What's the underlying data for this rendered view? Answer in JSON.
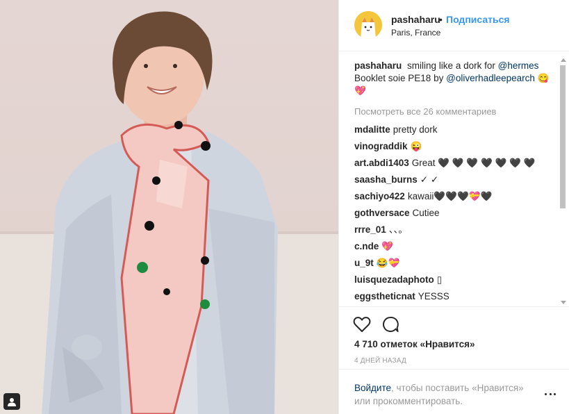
{
  "post": {
    "username": "pashaharu",
    "separator": "•",
    "follow_label": "Подписаться",
    "location": "Paris, France",
    "caption": {
      "username": "pashaharu",
      "text_1": "smiling like a dork for",
      "mention_1": "@hermes",
      "text_2": "Booklet soie PE18 by",
      "mention_2": "@oliverhadleepearch",
      "emoji": "😋💖"
    },
    "load_more_label": "Посмотреть все 26 комментариев",
    "comments": [
      {
        "user": "mdalitte",
        "text": "pretty dork"
      },
      {
        "user": "vinograddik",
        "text": "😜"
      },
      {
        "user": "art.abdi1403",
        "text": "Great 🖤 🖤 🖤 🖤 🖤 🖤 🖤"
      },
      {
        "user": "saasha_burns",
        "text": "✓ ✓"
      },
      {
        "user": "sachiyo422",
        "text": "kawaii🖤🖤🖤💝🖤"
      },
      {
        "user": "gothversace",
        "text": "Cutiee"
      },
      {
        "user": "rrre_01",
        "text": "、、。"
      },
      {
        "user": "c.nde",
        "text": "💖"
      },
      {
        "user": "u_9t",
        "text": "😂💝"
      },
      {
        "user": "luisquezadaphoto",
        "text": "▯"
      },
      {
        "user": "eggstheticnat",
        "text": "YESSS"
      }
    ],
    "likes_label": "4 710 отметок «Нравится»",
    "time_ago": "4 дней назад",
    "login": {
      "link": "Войдите",
      "text": ", чтобы поставить «Нравится» или прокомментировать."
    }
  },
  "icons": {
    "like": "heart-icon",
    "comment": "comment-icon",
    "more": "more-options-icon",
    "user_tag": "user-tag-icon"
  },
  "colors": {
    "link_blue": "#3897f0",
    "mention": "#003569",
    "muted": "#999999",
    "text": "#262626"
  }
}
